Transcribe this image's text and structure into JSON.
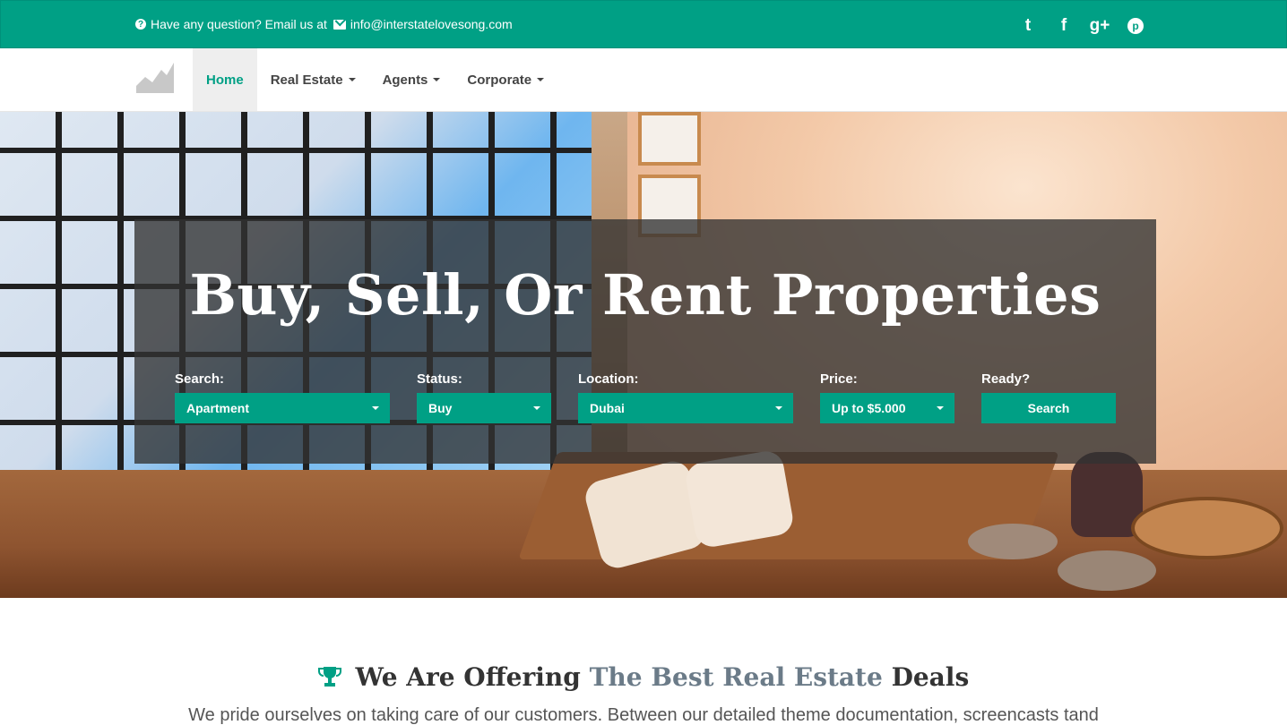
{
  "topbar": {
    "contact_prefix": "Have any question? Email us at",
    "email": "info@interstatelovesong.com",
    "social": [
      {
        "icon": "twitter-icon",
        "glyph": "t"
      },
      {
        "icon": "facebook-icon",
        "glyph": "f"
      },
      {
        "icon": "google-plus-icon",
        "glyph": "g+"
      },
      {
        "icon": "pinterest-icon",
        "glyph": "p"
      }
    ]
  },
  "nav": {
    "items": [
      {
        "label": "Home",
        "active": true
      },
      {
        "label": "Real Estate",
        "dropdown": true
      },
      {
        "label": "Agents",
        "dropdown": true
      },
      {
        "label": "Corporate",
        "dropdown": true
      }
    ]
  },
  "hero": {
    "headline": "Buy, Sell, Or Rent Properties",
    "fields": [
      {
        "label": "Search:",
        "value": "Apartment"
      },
      {
        "label": "Status:",
        "value": "Buy"
      },
      {
        "label": "Location:",
        "value": "Dubai"
      },
      {
        "label": "Price:",
        "value": "Up to $5.000"
      },
      {
        "label": "Ready?",
        "button": "Search"
      }
    ]
  },
  "intro": {
    "title_a": "We Are Offering",
    "title_b": "The Best Real Estate",
    "title_c": "Deals",
    "text": "We pride ourselves on taking care of our customers. Between our detailed theme documentation, screencasts tand"
  },
  "colors": {
    "accent": "#00a085",
    "panel": "#323232",
    "muted": "#6b7b88"
  }
}
